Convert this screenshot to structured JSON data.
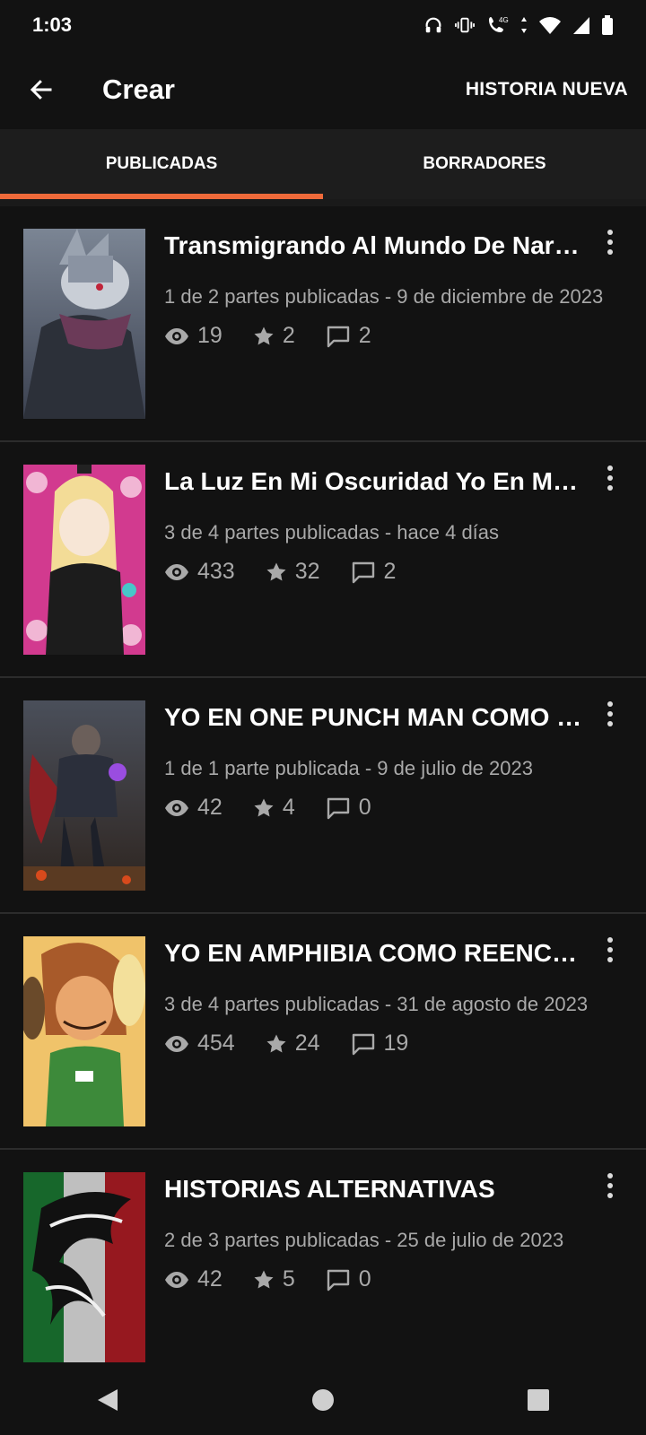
{
  "status": {
    "time": "1:03",
    "network_label": "4G"
  },
  "app_bar": {
    "title": "Crear",
    "action_label": "HISTORIA NUEVA"
  },
  "tabs": [
    {
      "label": "PUBLICADAS",
      "active": true
    },
    {
      "label": "BORRADORES",
      "active": false
    }
  ],
  "colors": {
    "accent": "#ef6a3a",
    "background": "#121212",
    "secondary_text": "#a9a9a9"
  },
  "stories": [
    {
      "title": "Transmigrando Al Mundo De Narut…",
      "meta": "1 de 2 partes publicadas - 9 de diciembre de 2023",
      "views": "19",
      "votes": "2",
      "comments": "2"
    },
    {
      "title": "La Luz En Mi Oscuridad Yo En Mar…",
      "meta": "3 de 4 partes publicadas - hace 4 días",
      "views": "433",
      "votes": "32",
      "comments": "2"
    },
    {
      "title": "YO  EN ONE PUNCH MAN COMO U…",
      "meta": "1 de 1 parte publicada - 9 de julio de 2023",
      "views": "42",
      "votes": "4",
      "comments": "0"
    },
    {
      "title": "YO EN AMPHIBIA COMO REENCAR…",
      "meta": "3 de 4 partes publicadas - 31 de agosto de 2023",
      "views": "454",
      "votes": "24",
      "comments": "19"
    },
    {
      "title": "HISTORIAS ALTERNATIVAS",
      "meta": "2 de 3 partes publicadas - 25 de julio de 2023",
      "views": "42",
      "votes": "5",
      "comments": "0"
    }
  ]
}
